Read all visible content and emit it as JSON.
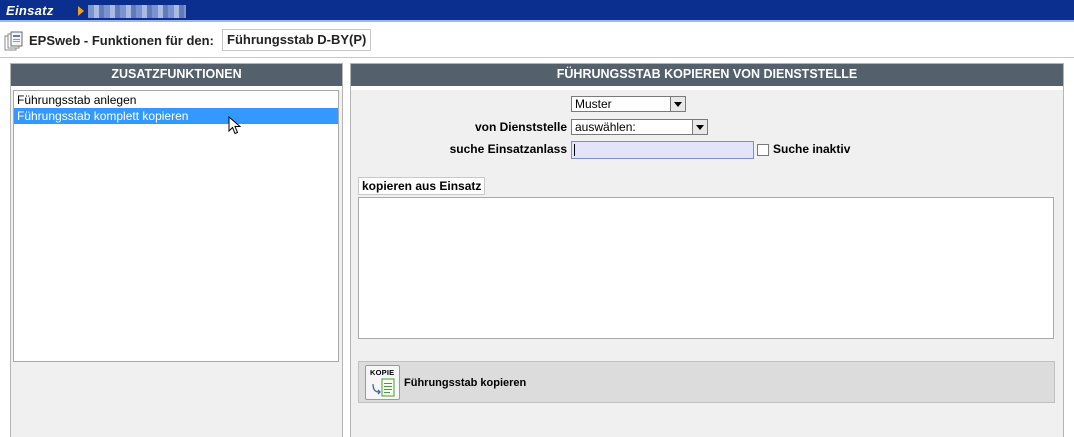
{
  "topbar": {
    "brand": "Einsatz",
    "user_obscured": true
  },
  "header": {
    "title_label": "EPSweb - Funktionen für den:",
    "title_value": "Führungsstab D-BY(P)"
  },
  "left_panel": {
    "heading": "ZUSATZFUNKTIONEN",
    "items": [
      {
        "label": "Führungsstab anlegen",
        "selected": false
      },
      {
        "label": "Führungsstab komplett kopieren",
        "selected": true
      }
    ]
  },
  "right_panel": {
    "heading": "FÜHRUNGSSTAB KOPIEREN VON DIENSTSTELLE",
    "muster_select": {
      "value": "Muster"
    },
    "dienststelle": {
      "label": "von Dienststelle",
      "value": "auswählen:"
    },
    "einsatzanlass": {
      "label": "suche Einsatzanlass",
      "value": ""
    },
    "suche_inaktiv": {
      "label": "Suche inaktiv",
      "checked": false
    },
    "kopieren_section": {
      "label": "kopieren aus Einsatz"
    },
    "action": {
      "icon_text": "KOPIE",
      "label": "Führungsstab kopieren"
    }
  },
  "colors": {
    "topbar": "#0b2f8f",
    "panel_header": "#54606c",
    "selection": "#3399ff",
    "input_focus": "#e3e3fb"
  },
  "icons": [
    "documents-icon",
    "dropdown-arrow-icon",
    "kopie-document-icon",
    "mouse-cursor-icon"
  ]
}
